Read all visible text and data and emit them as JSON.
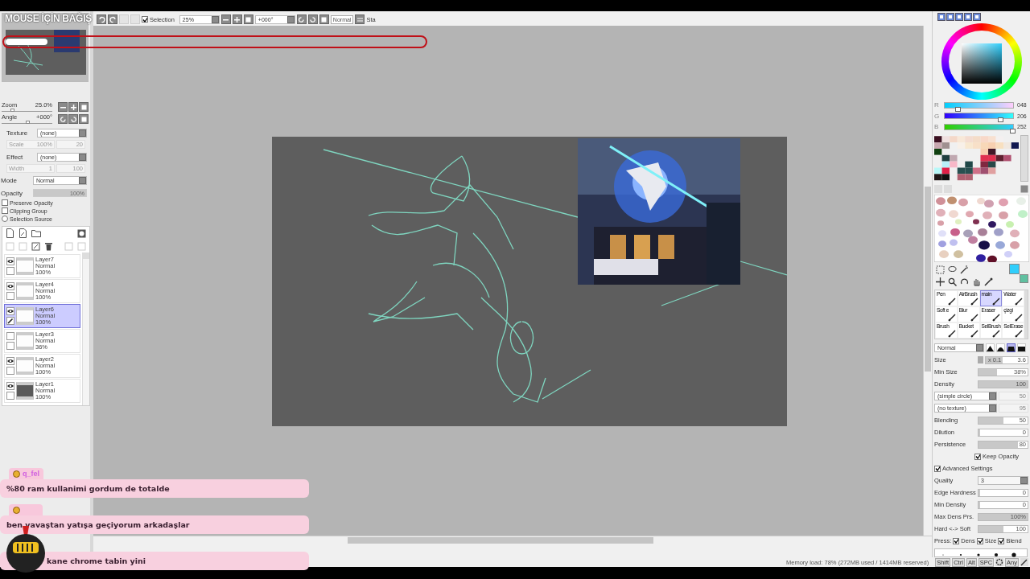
{
  "overlay": {
    "title": "MOUSE İÇİN BAĞIŞ",
    "progress": {
      "level": 0.1
    }
  },
  "toolbar": {
    "selection": {
      "label": "Selection",
      "checked": true
    },
    "zoom": "25%",
    "angle": "+000°",
    "mode": "Normal",
    "stabilizer": "Sta"
  },
  "navigator": {
    "zoom": {
      "label": "Zoom",
      "value": "25.0%",
      "level": 0.2
    },
    "angle": {
      "label": "Angle",
      "value": "+000°",
      "level": 0.5
    }
  },
  "texture": {
    "label": "Texture",
    "value": "(none)",
    "param": {
      "label": "Scale",
      "value": "100%"
    },
    "param_value": "20"
  },
  "effect": {
    "label": "Effect",
    "value": "(none)",
    "param": {
      "label": "Width",
      "value": "1"
    },
    "param_value": "100"
  },
  "layer_props": {
    "mode_label": "Mode",
    "mode": "Normal",
    "opacity_label": "Opacity",
    "opacity": {
      "value": "100%",
      "level": 1
    }
  },
  "options": [
    {
      "kind": "checkbox",
      "label": "Preserve Opacity",
      "checked": false
    },
    {
      "kind": "checkbox",
      "label": "Clipping Group",
      "checked": false
    },
    {
      "kind": "radio",
      "label": "Selection Source",
      "checked": false
    }
  ],
  "layers": [
    {
      "name": "Layer7",
      "mode": "Normal",
      "opacity": "100%",
      "visible": true,
      "editing": false,
      "selected": false,
      "dark": false
    },
    {
      "name": "Layer4",
      "mode": "Normal",
      "opacity": "100%",
      "visible": true,
      "editing": false,
      "selected": false,
      "dark": false
    },
    {
      "name": "Layer6",
      "mode": "Normal",
      "opacity": "100%",
      "visible": true,
      "editing": true,
      "selected": true,
      "dark": false
    },
    {
      "name": "Layer3",
      "mode": "Normal",
      "opacity": "36%",
      "visible": false,
      "editing": false,
      "selected": false,
      "dark": false
    },
    {
      "name": "Layer2",
      "mode": "Normal",
      "opacity": "100%",
      "visible": true,
      "editing": false,
      "selected": false,
      "dark": false
    },
    {
      "name": "Layer1",
      "mode": "Normal",
      "opacity": "100%",
      "visible": true,
      "editing": false,
      "selected": false,
      "dark": true
    }
  ],
  "color": {
    "channels": [
      {
        "label": "R",
        "value": "048",
        "level": 0.19
      },
      {
        "label": "G",
        "value": "206",
        "level": 0.81
      },
      {
        "label": "B",
        "value": "252",
        "level": 0.99
      }
    ]
  },
  "tools": [
    {
      "label": "Pen",
      "selected": false
    },
    {
      "label": "AirBrush",
      "selected": false
    },
    {
      "label": "main",
      "selected": true
    },
    {
      "label": "Water",
      "selected": false
    },
    {
      "label": "Soft e",
      "selected": false
    },
    {
      "label": "Blur",
      "selected": false
    },
    {
      "label": "Eraser",
      "selected": false
    },
    {
      "label": "çizgi",
      "selected": false
    },
    {
      "label": "Brush",
      "selected": false
    },
    {
      "label": "Bucket",
      "selected": false
    },
    {
      "label": "SelBrush",
      "selected": false
    },
    {
      "label": "SelErase",
      "selected": false
    }
  ],
  "brush": {
    "mode": "Normal",
    "tips": [
      {
        "selected": false
      },
      {
        "selected": false
      },
      {
        "selected": true
      },
      {
        "selected": false
      }
    ],
    "settings": [
      {
        "kind": "size",
        "label": "Size",
        "scale": "x 0.1",
        "value": "3.6",
        "level": 0.4
      },
      {
        "kind": "slider",
        "label": "Min Size",
        "value": "38%",
        "level": 0.38
      },
      {
        "kind": "slider",
        "label": "Density",
        "value": "100",
        "level": 1
      },
      {
        "kind": "select",
        "value": "(simple circle)",
        "extra": "50"
      },
      {
        "kind": "select",
        "value": "(no texture)",
        "extra": "95"
      },
      {
        "kind": "slider",
        "label": "Blending",
        "value": "50",
        "level": 0.5
      },
      {
        "kind": "slider",
        "label": "Dilution",
        "value": "0",
        "level": 0
      },
      {
        "kind": "slider",
        "label": "Persistence",
        "value": "80",
        "level": 0.8
      },
      {
        "kind": "sub-checkbox",
        "label": "Keep Opacity",
        "checked": true
      },
      {
        "kind": "checkbox",
        "label": "Advanced Settings",
        "checked": true
      },
      {
        "kind": "labeled-select",
        "label": "Quality",
        "value": "3"
      },
      {
        "kind": "slider",
        "label": "Edge Hardness",
        "value": "0",
        "level": 0
      },
      {
        "kind": "slider",
        "label": "Min Density",
        "value": "0",
        "level": 0
      },
      {
        "kind": "slider",
        "label": "Max Dens Prs.",
        "value": "100%",
        "level": 1
      },
      {
        "kind": "slider",
        "label": "Hard <-> Soft",
        "value": "100",
        "level": 0.5
      },
      {
        "kind": "press",
        "label": "Press:",
        "checks": [
          {
            "label": "Dens",
            "checked": true
          },
          {
            "label": "Size",
            "checked": true
          },
          {
            "label": "Blend",
            "checked": true
          }
        ]
      }
    ]
  },
  "status_bar": {
    "memory": "Memory load: 78% (272MB used / 1414MB reserved)",
    "keys": [
      "Shift",
      "Ctrl",
      "Alt",
      "SPC"
    ],
    "last_key": "Any"
  },
  "chat": [
    {
      "kind": "tagged",
      "user": "q_fel",
      "message": "%80 ram kullanimi gordum de totalde"
    },
    {
      "kind": "tagged",
      "message": "ben yavaştan yatışa geçiyorum arkadaşlar"
    },
    {
      "kind": "plain",
      "message": "kane chrome tabin yini"
    }
  ]
}
